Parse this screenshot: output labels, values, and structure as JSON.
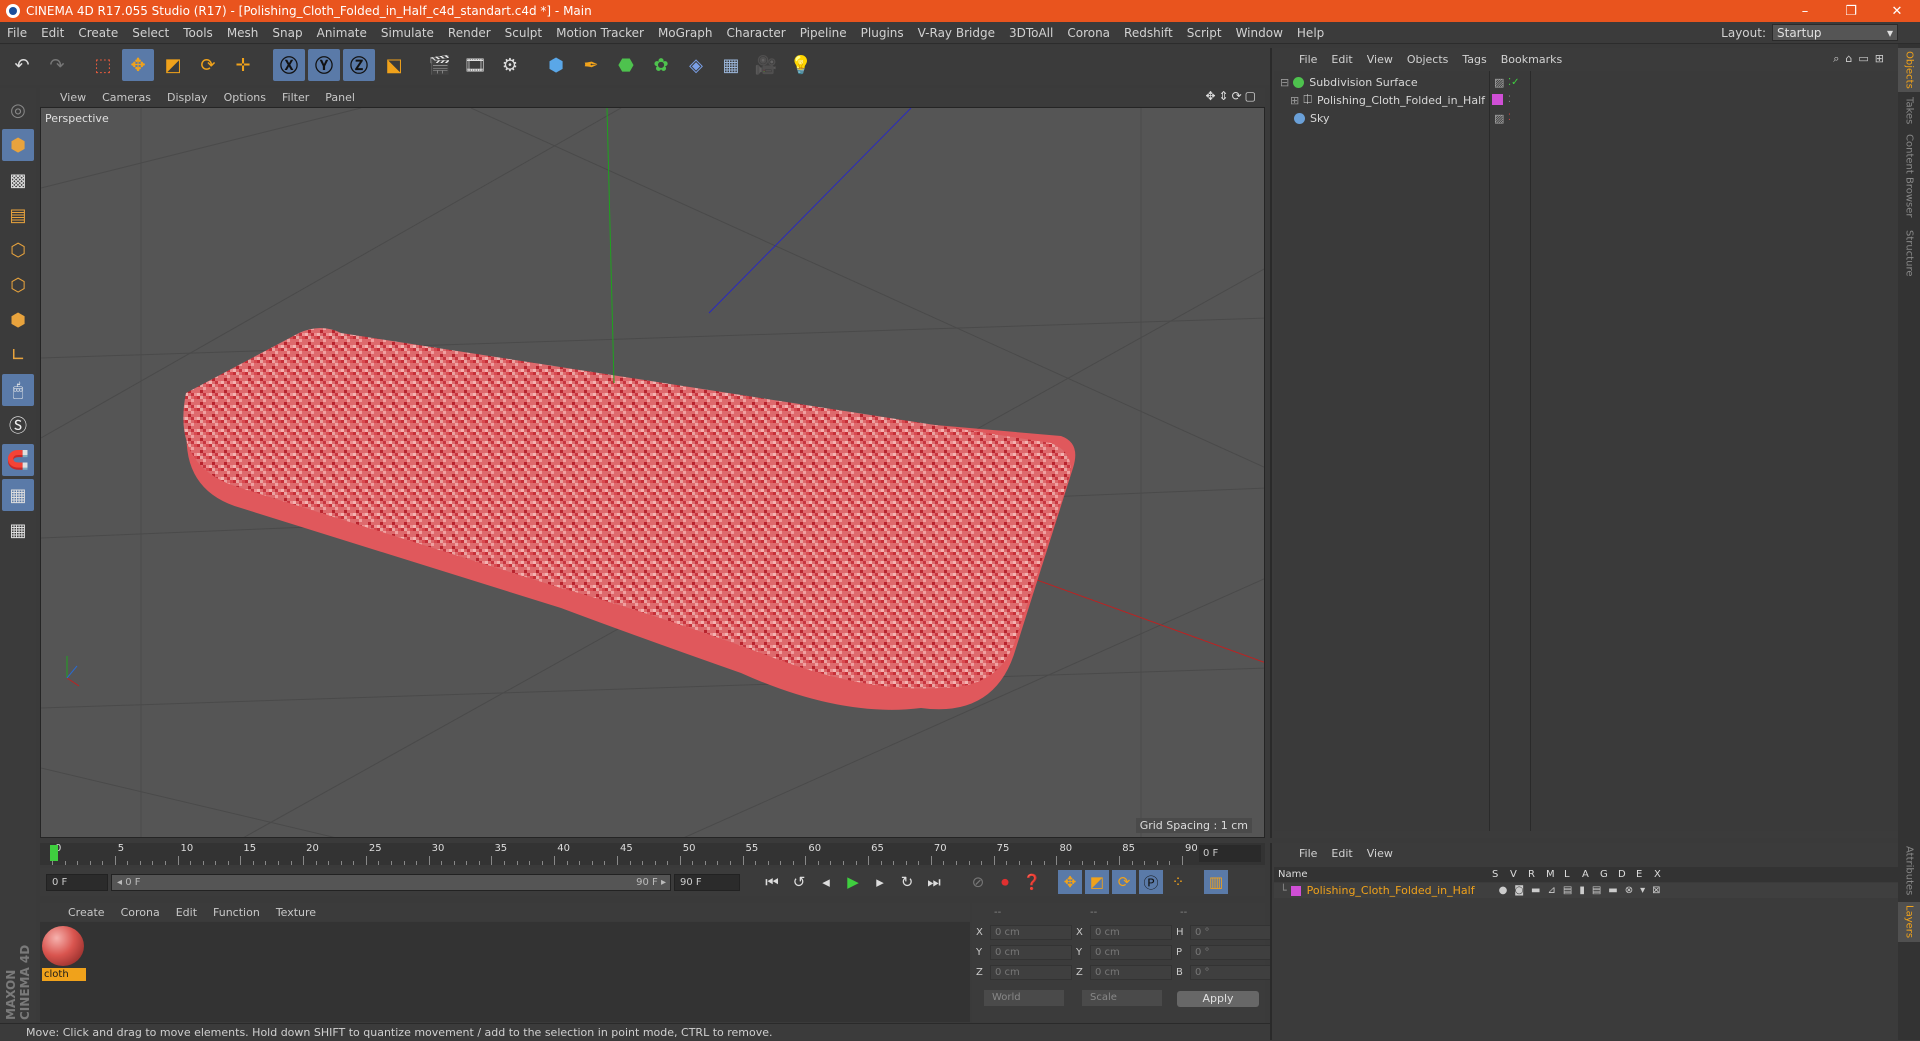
{
  "app": {
    "title": "CINEMA 4D R17.055 Studio (R17) - [Polishing_Cloth_Folded_in_Half_c4d_standart.c4d *] - Main",
    "window_buttons": [
      "–",
      "❐",
      "✕"
    ]
  },
  "menubar": {
    "items": [
      "File",
      "Edit",
      "Create",
      "Select",
      "Tools",
      "Mesh",
      "Snap",
      "Animate",
      "Simulate",
      "Render",
      "Sculpt",
      "Motion Tracker",
      "MoGraph",
      "Character",
      "Pipeline",
      "Plugins",
      "V-Ray Bridge",
      "3DToAll",
      "Corona",
      "Redshift",
      "Script",
      "Window",
      "Help"
    ],
    "layout_label": "Layout:",
    "layout_value": "Startup"
  },
  "toolbar": {
    "icons": [
      "undo-icon",
      "redo-icon",
      "live-selection-icon",
      "move-icon",
      "scale-icon",
      "rotate-icon",
      "last-tool-icon",
      "x-axis-icon",
      "y-axis-icon",
      "z-axis-icon",
      "world-coordinates-icon",
      "render-view-icon",
      "render-picture-viewer-icon",
      "edit-render-settings-icon",
      "cube-icon",
      "pen-spline-icon",
      "subdivision-surface-icon",
      "cloner-icon",
      "deformer-icon",
      "floor-icon",
      "camera-icon",
      "light-icon"
    ]
  },
  "viewport": {
    "menu": [
      "View",
      "Cameras",
      "Display",
      "Options",
      "Filter",
      "Panel"
    ],
    "camera_label": "Perspective",
    "grid_spacing": "Grid Spacing : 1 cm",
    "cloth_color": "#e0585c"
  },
  "timeline": {
    "ticks": [
      "0",
      "5",
      "10",
      "15",
      "20",
      "25",
      "30",
      "35",
      "40",
      "45",
      "50",
      "55",
      "60",
      "65",
      "70",
      "75",
      "80",
      "85",
      "90"
    ],
    "current_frame": "0 F"
  },
  "transport": {
    "start_field": "0 F",
    "range_start": "◂ 0 F",
    "range_end": "90 F ▸",
    "end_field": "90 F"
  },
  "material_manager": {
    "menu": [
      "Create",
      "Corona",
      "Edit",
      "Function",
      "Texture"
    ],
    "materials": [
      {
        "name": "cloth"
      }
    ]
  },
  "coordinates": {
    "headers": [
      "--",
      "--",
      "--"
    ],
    "rows": [
      {
        "a": "X",
        "av": "0 cm",
        "b": "X",
        "bv": "0 cm",
        "c": "H",
        "cv": "0 °"
      },
      {
        "a": "Y",
        "av": "0 cm",
        "b": "Y",
        "bv": "0 cm",
        "c": "P",
        "cv": "0 °"
      },
      {
        "a": "Z",
        "av": "0 cm",
        "b": "Z",
        "bv": "0 cm",
        "c": "B",
        "cv": "0 °"
      }
    ],
    "mode_world": "World",
    "mode_scale": "Scale",
    "apply": "Apply"
  },
  "object_manager": {
    "menu": [
      "File",
      "Edit",
      "View",
      "Objects",
      "Tags",
      "Bookmarks"
    ],
    "objects": [
      {
        "name": "Subdivision Surface",
        "icon_color": "#4ec24e",
        "indent": 0
      },
      {
        "name": "Polishing_Cloth_Folded_in_Half",
        "icon_color": "#cfcfcf",
        "indent": 1
      },
      {
        "name": "Sky",
        "icon_color": "#6aa0d8",
        "indent": 0
      }
    ],
    "tag_color": "#d04fd6"
  },
  "layer_manager": {
    "menu": [
      "File",
      "Edit",
      "View"
    ],
    "columns": [
      "Name",
      "S",
      "V",
      "R",
      "M",
      "L",
      "A",
      "G",
      "D",
      "E",
      "X"
    ],
    "layers": [
      {
        "name": "Polishing_Cloth_Folded_in_Half",
        "color": "#d04fd6"
      }
    ]
  },
  "right_tabs": [
    "Objects",
    "Takes",
    "Content Browser",
    "Structure",
    "Attributes",
    "Layers"
  ],
  "status": "Move: Click and drag to move elements. Hold down SHIFT to quantize movement / add to the selection in point mode, CTRL to remove.",
  "branding": "MAXON CINEMA 4D"
}
